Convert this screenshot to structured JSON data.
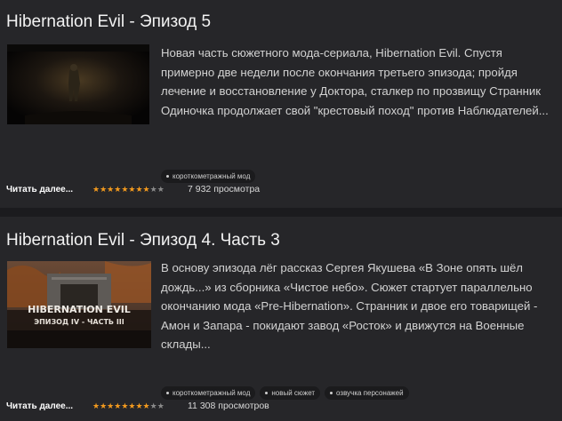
{
  "colors": {
    "background": "#1b1b1e",
    "card": "#262629",
    "star_on": "#f39a1e",
    "star_off": "#8a8a8a"
  },
  "articles": [
    {
      "title": "Hibernation Evil - Эпизод 5",
      "description": "Новая часть сюжетного мода-сериала, Hibernation Evil. Спустя примерно две недели после окончания третьего эпизода; пройдя лечение и восстановление у Доктора, сталкер по прозвищу Странник Одиночка продолжает свой \"крестовый поход\" против Наблюдателей...",
      "tags": [
        "короткометражный мод"
      ],
      "read_more": "Читать далее...",
      "rating_stars": 8,
      "max_stars": 10,
      "views": "7 932 просмотра"
    },
    {
      "title": "Hibernation Evil - Эпизод 4. Часть 3",
      "thumbnail_text": [
        "HIBERNATION EVIL",
        "ЭПИЗОД IV - ЧАСТЬ III"
      ],
      "description": "В основу эпизода лёг рассказ Сергея Якушева «В Зоне опять шёл дождь...» из сборника «Чистое небо». Сюжет стартует параллельно окончанию мода «Pre-Hibernation». Странник и двое его товарищей - Амон и Запара - покидают завод «Росток» и движутся на Военные склады...",
      "tags": [
        "короткометражный мод",
        "новый сюжет",
        "озвучка персонажей"
      ],
      "read_more": "Читать далее...",
      "rating_stars": 8,
      "max_stars": 10,
      "views": "11 308 просмотров"
    }
  ]
}
